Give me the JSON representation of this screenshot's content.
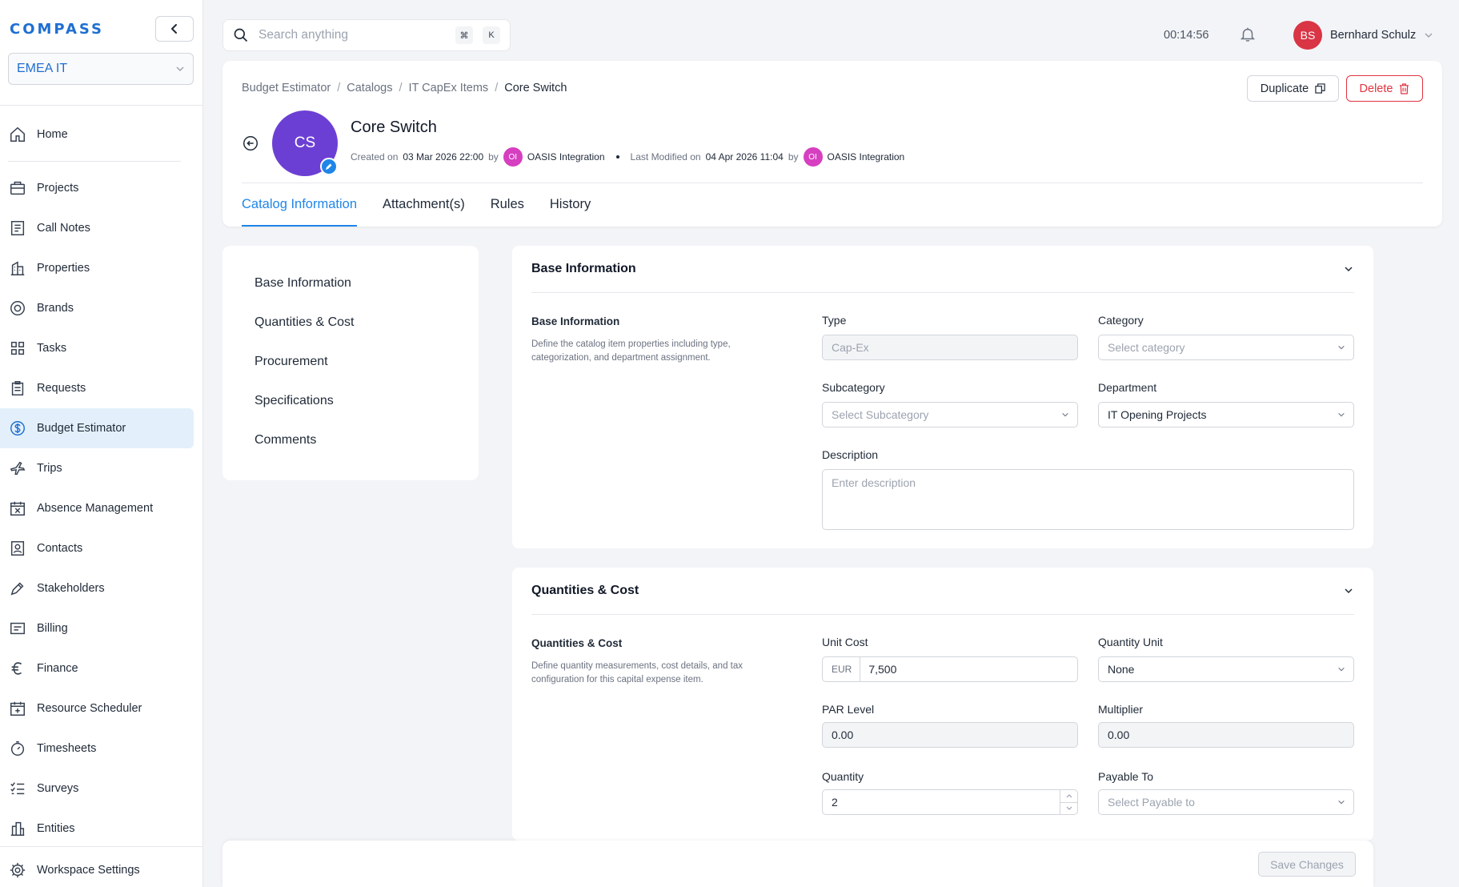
{
  "app": {
    "logo": "COMPASS",
    "org": "EMEA IT"
  },
  "sidebar": {
    "items": [
      {
        "label": "Home",
        "icon": "home-icon"
      },
      {
        "label": "Projects",
        "icon": "briefcase-icon"
      },
      {
        "label": "Call Notes",
        "icon": "notes-icon"
      },
      {
        "label": "Properties",
        "icon": "building-icon"
      },
      {
        "label": "Brands",
        "icon": "badge-icon"
      },
      {
        "label": "Tasks",
        "icon": "grid-icon"
      },
      {
        "label": "Requests",
        "icon": "clipboard-icon"
      },
      {
        "label": "Budget Estimator",
        "icon": "dollar-icon",
        "active": true
      },
      {
        "label": "Trips",
        "icon": "plane-icon"
      },
      {
        "label": "Absence Management",
        "icon": "calendar-x-icon"
      },
      {
        "label": "Contacts",
        "icon": "contact-icon"
      },
      {
        "label": "Stakeholders",
        "icon": "pen-icon"
      },
      {
        "label": "Billing",
        "icon": "billing-icon"
      },
      {
        "label": "Finance",
        "icon": "euro-icon"
      },
      {
        "label": "Resource Scheduler",
        "icon": "calendar-plus-icon"
      },
      {
        "label": "Timesheets",
        "icon": "stopwatch-icon"
      },
      {
        "label": "Surveys",
        "icon": "checklist-icon"
      },
      {
        "label": "Entities",
        "icon": "entity-icon"
      }
    ],
    "settings_label": "Workspace Settings"
  },
  "topbar": {
    "search_placeholder": "Search anything",
    "shortcut_cmd": "⌘",
    "shortcut_key": "K",
    "timer": "00:14:56",
    "user_initials": "BS",
    "user_name": "Bernhard Schulz"
  },
  "header": {
    "breadcrumb": [
      "Budget Estimator",
      "Catalogs",
      "IT CapEx Items",
      "Core Switch"
    ],
    "duplicate_label": "Duplicate",
    "delete_label": "Delete",
    "avatar_initials": "CS",
    "title": "Core Switch",
    "created_on_label": "Created on",
    "created_on": "03 Mar 2026 22:00",
    "by_label": "by",
    "creator_initials": "OI",
    "creator": "OASIS Integration",
    "modified_label": "Last Modified on",
    "modified_on": "04 Apr 2026 11:04",
    "modifier_initials": "OI",
    "modifier": "OASIS Integration",
    "tabs": [
      "Catalog Information",
      "Attachment(s)",
      "Rules",
      "History"
    ]
  },
  "section_nav": [
    "Base Information",
    "Quantities & Cost",
    "Procurement",
    "Specifications",
    "Comments"
  ],
  "base_info": {
    "panel_title": "Base Information",
    "sub_title": "Base Information",
    "description": "Define the catalog item properties including type, categorization, and department assignment.",
    "type_label": "Type",
    "type_value": "Cap-Ex",
    "category_label": "Category",
    "category_placeholder": "Select category",
    "subcategory_label": "Subcategory",
    "subcategory_placeholder": "Select Subcategory",
    "department_label": "Department",
    "department_value": "IT Opening Projects",
    "desc_label": "Description",
    "desc_placeholder": "Enter description"
  },
  "qty_cost": {
    "panel_title": "Quantities & Cost",
    "sub_title": "Quantities & Cost",
    "description": "Define quantity measurements, cost details, and tax configuration for this capital expense item.",
    "unit_cost_label": "Unit Cost",
    "currency": "EUR",
    "unit_cost_value": "7,500",
    "qty_unit_label": "Quantity Unit",
    "qty_unit_value": "None",
    "par_label": "PAR Level",
    "par_value": "0.00",
    "multiplier_label": "Multiplier",
    "multiplier_value": "0.00",
    "quantity_label": "Quantity",
    "quantity_value": "2",
    "payable_label": "Payable To",
    "payable_placeholder": "Select Payable to"
  },
  "footer": {
    "save_label": "Save Changes"
  }
}
